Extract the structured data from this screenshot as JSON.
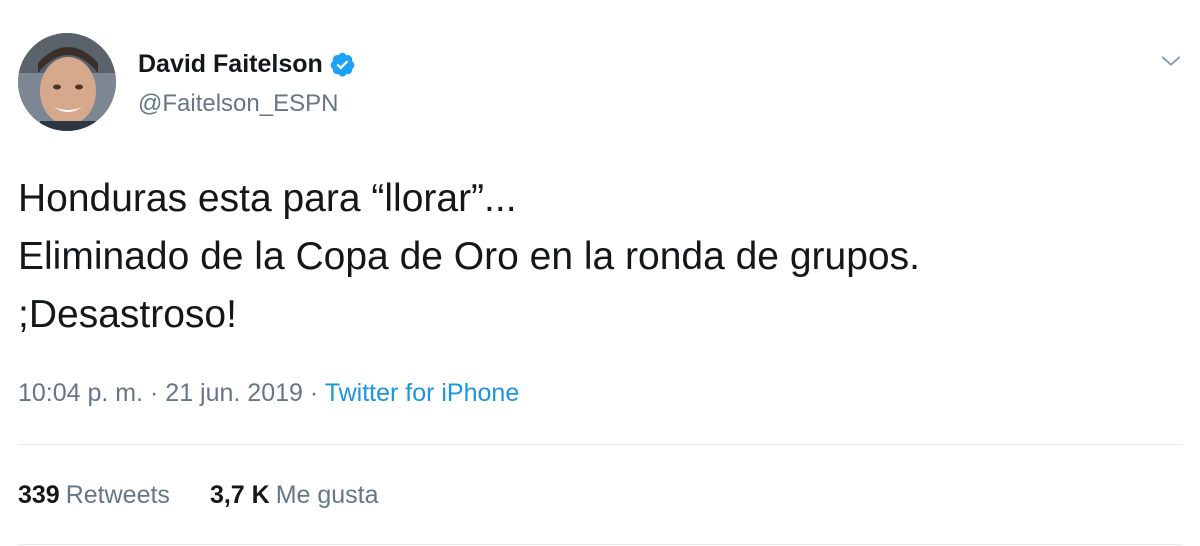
{
  "author": {
    "display_name": "David Faitelson",
    "handle": "@Faitelson_ESPN",
    "verified": true,
    "avatar_icon": "profile-photo"
  },
  "tweet": {
    "lines": [
      "Honduras esta para “llorar”...",
      "Eliminado de la Copa de Oro en la ronda de grupos.",
      ";Desastroso!"
    ],
    "time": "10:04 p. m.",
    "date": "21 jun. 2019",
    "separator": " · ",
    "source": "Twitter for iPhone"
  },
  "stats": {
    "retweets_count": "339",
    "retweets_label": "Retweets",
    "likes_count": "3,7 K",
    "likes_label": "Me gusta"
  },
  "icons": {
    "verified": "verified-badge-icon",
    "menu": "chevron-down-icon"
  },
  "colors": {
    "text_primary": "#14171a",
    "text_secondary": "#657786",
    "accent": "#1b95e0",
    "verified": "#1da1f2",
    "divider": "#e6ecf0"
  }
}
